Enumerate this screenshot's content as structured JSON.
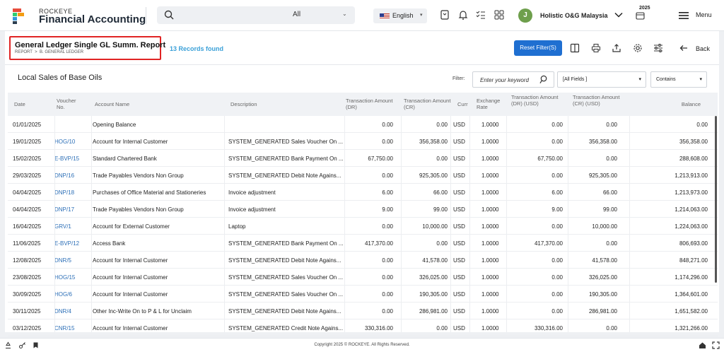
{
  "app": {
    "brand_small": "ROCKEYE",
    "brand_title": "Financial Accounting"
  },
  "search": {
    "scope": "All"
  },
  "language": {
    "label": "English"
  },
  "user": {
    "initial": "J",
    "company": "Holistic O&G Malaysia",
    "year": "2025"
  },
  "menu_label": "Menu",
  "report": {
    "title": "General Ledger Single GL Summ. Report",
    "breadcrumb": [
      "REPORT",
      "B. GENERAL LEDGER"
    ],
    "records": "13 Records found",
    "reset_label": "Reset Filter(S)",
    "back_label": "Back"
  },
  "table": {
    "title": "Local Sales of Base Oils",
    "filter_label": "Filter:",
    "keyword_placeholder": "Enter your keyword",
    "field_select": "[All Fields ]",
    "match_select": "Contains",
    "columns": [
      "Date",
      "Voucher No.",
      "Account Name",
      "Description",
      "Transaction Amount (DR)",
      "Transaction Amount (CR)",
      "Curr",
      "Exchange Rate",
      "Transaction Amount (DR) (USD)",
      "Transaction Amount (CR) (USD)",
      "Balance"
    ],
    "rows": [
      [
        "01/01/2025",
        "",
        "Opening Balance",
        "",
        "0.00",
        "0.00",
        "USD",
        "1.0000",
        "0.00",
        "0.00",
        "0.00"
      ],
      [
        "19/01/2025",
        "HOG/10",
        "Account for Internal Customer",
        "SYSTEM_GENERATED Sales Voucher On ...",
        "0.00",
        "356,358.00",
        "USD",
        "1.0000",
        "0.00",
        "356,358.00",
        "356,358.00"
      ],
      [
        "15/02/2025",
        "E-BVP/15",
        "Standard Chartered Bank",
        "SYSTEM_GENERATED Bank Payment On ...",
        "67,750.00",
        "0.00",
        "USD",
        "1.0000",
        "67,750.00",
        "0.00",
        "288,608.00"
      ],
      [
        "29/03/2025",
        "DNP/16",
        "Trade Payables Vendors Non Group",
        "SYSTEM_GENERATED Debit Note Agains...",
        "0.00",
        "925,305.00",
        "USD",
        "1.0000",
        "0.00",
        "925,305.00",
        "1,213,913.00"
      ],
      [
        "04/04/2025",
        "DNP/18",
        "Purchases of Office Material and Stationeries",
        "Invoice adjustment",
        "6.00",
        "66.00",
        "USD",
        "1.0000",
        "6.00",
        "66.00",
        "1,213,973.00"
      ],
      [
        "04/04/2025",
        "DNP/17",
        "Trade Payables Vendors Non Group",
        "Invoice adjustment",
        "9.00",
        "99.00",
        "USD",
        "1.0000",
        "9.00",
        "99.00",
        "1,214,063.00"
      ],
      [
        "16/04/2025",
        "GRV/1",
        "Account for External Customer",
        "Laptop",
        "0.00",
        "10,000.00",
        "USD",
        "1.0000",
        "0.00",
        "10,000.00",
        "1,224,063.00"
      ],
      [
        "11/06/2025",
        "E-BVP/12",
        "Access Bank",
        "SYSTEM_GENERATED Bank Payment On ...",
        "417,370.00",
        "0.00",
        "USD",
        "1.0000",
        "417,370.00",
        "0.00",
        "806,693.00"
      ],
      [
        "12/08/2025",
        "DNR/5",
        "Account for Internal Customer",
        "SYSTEM_GENERATED Debit Note Agains...",
        "0.00",
        "41,578.00",
        "USD",
        "1.0000",
        "0.00",
        "41,578.00",
        "848,271.00"
      ],
      [
        "23/08/2025",
        "HOG/15",
        "Account for Internal Customer",
        "SYSTEM_GENERATED Sales Voucher On ...",
        "0.00",
        "326,025.00",
        "USD",
        "1.0000",
        "0.00",
        "326,025.00",
        "1,174,296.00"
      ],
      [
        "30/09/2025",
        "HOG/6",
        "Account for Internal Customer",
        "SYSTEM_GENERATED Sales Voucher On ...",
        "0.00",
        "190,305.00",
        "USD",
        "1.0000",
        "0.00",
        "190,305.00",
        "1,364,601.00"
      ],
      [
        "30/11/2025",
        "DNR/4",
        "Other Inc-Write On to P & L for Unclaim",
        "SYSTEM_GENERATED Debit Note Agains...",
        "0.00",
        "286,981.00",
        "USD",
        "1.0000",
        "0.00",
        "286,981.00",
        "1,651,582.00"
      ],
      [
        "03/12/2025",
        "CNR/15",
        "Account for Internal Customer",
        "SYSTEM_GENERATED Credit Note Agains...",
        "330,316.00",
        "0.00",
        "USD",
        "1.0000",
        "330,316.00",
        "0.00",
        "1,321,266.00"
      ]
    ]
  },
  "footer": {
    "copyright": "Copyright 2025 © ROCKEYE. All Rights Reserved."
  },
  "colors": {
    "primary": "#1f6fd1",
    "link": "#2c6fb7",
    "highlight": "#e02424",
    "records": "#3aa0d8",
    "avatar": "#6e9f4c"
  }
}
